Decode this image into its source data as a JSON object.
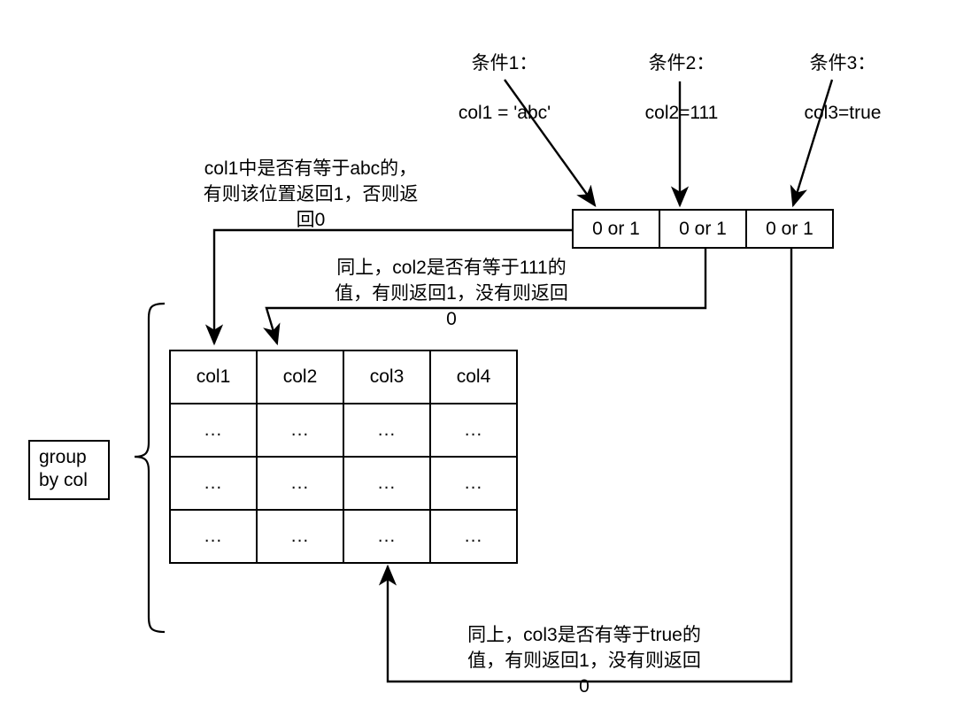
{
  "diagram": {
    "title": "group by col bitmap condition diagram",
    "conditions": [
      {
        "name": "条件1：",
        "expr": "col1 = 'abc'"
      },
      {
        "name": "条件2：",
        "expr": "col2=111"
      },
      {
        "name": "条件3：",
        "expr": "col3=true"
      }
    ],
    "bit_cells": [
      {
        "label": "0 or 1"
      },
      {
        "label": "0 or 1"
      },
      {
        "label": "0 or 1"
      }
    ],
    "annotations": {
      "col1_note": "col1中是否有等于abc的，\n有则该位置返回1，否则返\n回0",
      "col2_note": "同上，col2是否有等于111的\n值，有则返回1，没有则返回\n0",
      "col3_note": "同上，col3是否有等于true的\n值，有则返回1，没有则返回\n0"
    },
    "group_label": "group\nby col",
    "table": {
      "headers": [
        "col1",
        "col2",
        "col3",
        "col4"
      ],
      "rows": [
        [
          "...",
          "...",
          "...",
          "..."
        ],
        [
          "...",
          "...",
          "...",
          "..."
        ],
        [
          "...",
          "...",
          "...",
          "..."
        ]
      ]
    },
    "colors": {
      "stroke": "#000000",
      "background": "#ffffff",
      "text": "#000000"
    }
  }
}
